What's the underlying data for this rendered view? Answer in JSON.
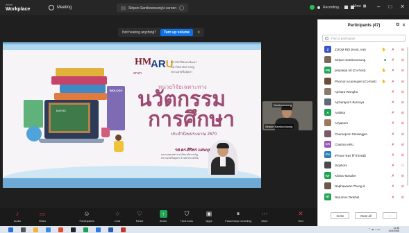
{
  "titlebar": {
    "brand_top": "zoom",
    "brand_bottom": "Workplace",
    "meeting_label": "Meeting",
    "screen_share_label": "Siripon Samboonsong's screen",
    "recording_label": "Recording...",
    "view_label": "View",
    "minimize": "–",
    "maximize": "□",
    "close": "✕"
  },
  "notice": {
    "text": "Not hearing anything?",
    "button": "Turn up volume",
    "close": "✕"
  },
  "slide": {
    "logo_hm": "HM",
    "logo_hm_sub": "สกสว",
    "logo_aru_a": "AR",
    "logo_aru_b": "U",
    "institute": "สถาบันวิจัยและพัฒนา มหาวิทยาลัยราชภัฏพระนครศรีอยุธยา",
    "unit_text": "หน่วยวิจัยเฉพาะทาง",
    "title_line1": "นวัตกรรม",
    "title_line2": "การศึกษา",
    "year_text": "ประจำปีงบประมาณ 2570",
    "presenter_name": "รศ.ดร.ศิริพร แสนบุญส่ง",
    "presenter_role": "คณะครุศาสตร์ มหาวิทยาลัยราชภัฏพระนครศรีอยุธยา หัวหน้าหน่วยวิจัย",
    "board_text": "MATHS",
    "book_label_1": "BIOLOGY"
  },
  "video_tile": {
    "name": "Siripon Samboonsong",
    "tag": "Samboonsong"
  },
  "participants": {
    "title": "Participants (47)",
    "search_placeholder": "Find a participant",
    "items": [
      {
        "initials": "Z",
        "name": "ZOOM RDI (Host, me)",
        "color": "#3b55c8",
        "icons": "hand"
      },
      {
        "initials": "",
        "name": "Siripon Samboonsong",
        "color": "#7a6a5e",
        "icons": "share"
      },
      {
        "initials": "PR",
        "name": "pimpinpa rdi (Co-host)",
        "color": "#1fa454",
        "icons": "hand"
      },
      {
        "initials": "",
        "name": "Phorson ucunsupen (Co-host)",
        "color": "#6a4e3a",
        "icons": "hand"
      },
      {
        "initials": "",
        "name": "Ajchara Wongha",
        "color": "#8a7a6a",
        "icons": ""
      },
      {
        "initials": "",
        "name": "Ajcharaporn Bunruya",
        "color": "#5e6a7a",
        "icons": ""
      },
      {
        "initials": "A",
        "name": "Anthika",
        "color": "#1fa454",
        "icons": ""
      },
      {
        "initials": "",
        "name": "Ariyaporn",
        "color": "#9a7a5a",
        "icons": ""
      },
      {
        "initials": "",
        "name": "Chureeporn Musangjun",
        "color": "#7a5a6a",
        "icons": ""
      },
      {
        "initials": "CA",
        "name": "Chutima ARU",
        "color": "#9b59b6",
        "icons": ""
      },
      {
        "initials": "Fu",
        "name": "iPhone ของ ฟ้ารวกอณ์",
        "color": "#2c7fb8",
        "icons": ""
      },
      {
        "initials": "",
        "name": "iSophorn",
        "color": "#4a4a4a",
        "icons": "cam"
      },
      {
        "initials": "KT",
        "name": "Khima Tamalee",
        "color": "#1fa454",
        "icons": ""
      },
      {
        "initials": "",
        "name": "Naphawaran Thong-in",
        "color": "#6a5a4a",
        "icons": ""
      },
      {
        "initials": "NT",
        "name": "Narumon Tankhet",
        "color": "#1fa454",
        "icons": ""
      }
    ],
    "invite_label": "Invite",
    "mute_all_label": "Mute all",
    "more_label": "···"
  },
  "toolbar": {
    "audio": "Audio",
    "video": "Video",
    "participants": "Participants",
    "participants_count": "47",
    "chat": "Chat",
    "react": "React",
    "share": "Share",
    "host_tools": "Host tools",
    "apps": "Apps",
    "pause_recording": "Pause/stop recording",
    "more": "More",
    "end": "End"
  },
  "taskbar": {
    "time": "11:36",
    "date": "19/3/2568"
  },
  "colors": {
    "accent": "#0e72ed",
    "danger": "#e0353f",
    "success": "#1fa454"
  }
}
